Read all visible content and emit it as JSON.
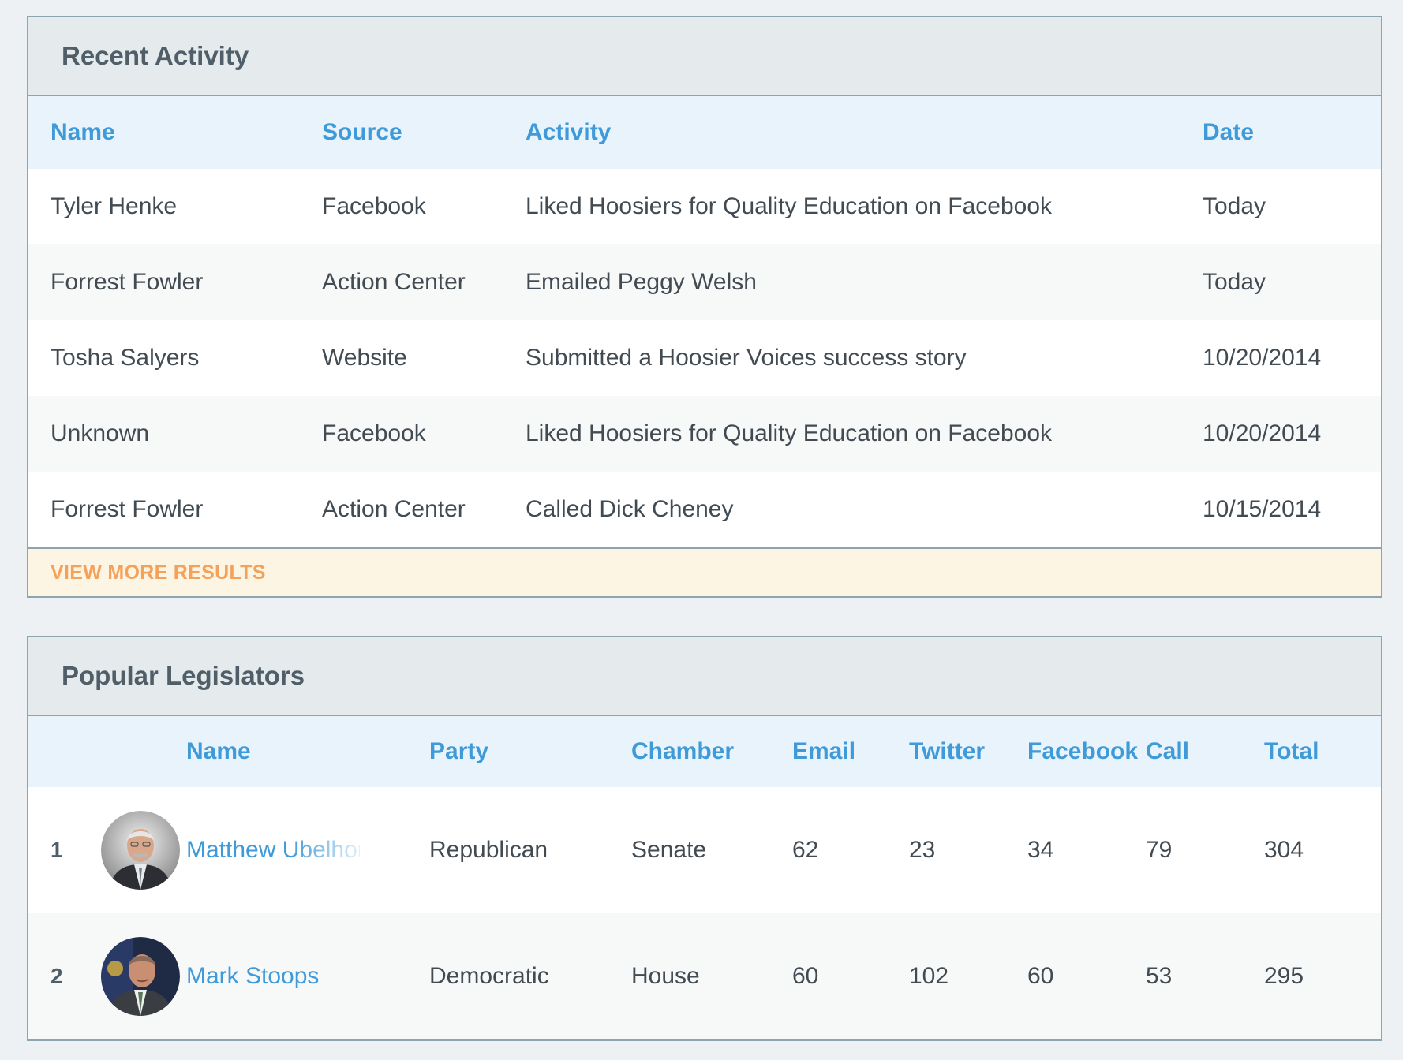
{
  "recent_activity": {
    "title": "Recent Activity",
    "columns": {
      "name": "Name",
      "source": "Source",
      "activity": "Activity",
      "date": "Date"
    },
    "rows": [
      {
        "name": "Tyler Henke",
        "source": "Facebook",
        "activity": "Liked Hoosiers for Quality Education on Facebook",
        "date": "Today"
      },
      {
        "name": "Forrest Fowler",
        "source": "Action Center",
        "activity": "Emailed Peggy Welsh",
        "date": "Today"
      },
      {
        "name": "Tosha Salyers",
        "source": "Website",
        "activity": "Submitted a Hoosier Voices success story",
        "date": "10/20/2014"
      },
      {
        "name": "Unknown",
        "source": "Facebook",
        "activity": "Liked Hoosiers for Quality Education on Facebook",
        "date": "10/20/2014"
      },
      {
        "name": "Forrest Fowler",
        "source": "Action Center",
        "activity": "Called Dick Cheney",
        "date": "10/15/2014"
      }
    ],
    "view_more_label": "VIEW MORE RESULTS"
  },
  "popular_legislators": {
    "title": "Popular Legislators",
    "columns": {
      "name": "Name",
      "party": "Party",
      "chamber": "Chamber",
      "email": "Email",
      "twitter": "Twitter",
      "facebook": "Facebook",
      "call": "Call",
      "total": "Total"
    },
    "rows": [
      {
        "rank": "1",
        "name": "Matthew Ubelhor",
        "party": "Republican",
        "chamber": "Senate",
        "email": "62",
        "twitter": "23",
        "facebook": "34",
        "call": "79",
        "total": "304"
      },
      {
        "rank": "2",
        "name": "Mark Stoops",
        "party": "Democratic",
        "chamber": "House",
        "email": "60",
        "twitter": "102",
        "facebook": "60",
        "call": "53",
        "total": "295"
      }
    ]
  },
  "colors": {
    "accent_blue": "#3e9ad8",
    "view_more_orange": "#f4a15a",
    "header_bg": "#e5eaed",
    "column_header_bg": "#e8f3fb",
    "border": "#8ea4b0"
  }
}
